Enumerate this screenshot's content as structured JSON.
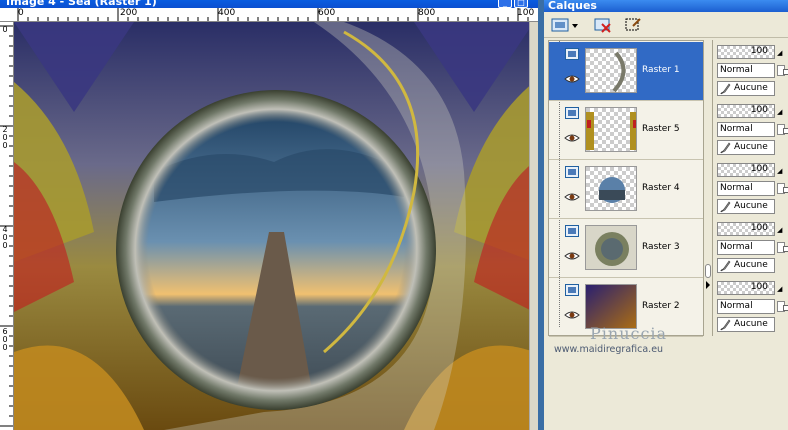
{
  "image_window": {
    "title": "Image 4 - Sea (Raster 1)",
    "ruler_h_labels": [
      "0",
      "200",
      "400",
      "600",
      "800",
      "100"
    ],
    "ruler_v_labels": [
      "0",
      "2 0 0",
      "4 0 0",
      "6 0 0"
    ],
    "title_buttons": [
      "_",
      "□"
    ]
  },
  "layers_panel": {
    "title": "Calques",
    "layers": [
      {
        "name": "Raster 1",
        "selected": true,
        "opacity": "100",
        "blend": "Normal",
        "mask": "Aucune",
        "thumb": "arc"
      },
      {
        "name": "Raster 5",
        "selected": false,
        "opacity": "100",
        "blend": "Normal",
        "mask": "Aucune",
        "thumb": "sides"
      },
      {
        "name": "Raster 4",
        "selected": false,
        "opacity": "100",
        "blend": "Normal",
        "mask": "Aucune",
        "thumb": "lens"
      },
      {
        "name": "Raster 3",
        "selected": false,
        "opacity": "100",
        "blend": "Normal",
        "mask": "Aucune",
        "thumb": "sphere"
      },
      {
        "name": "Raster 2",
        "selected": false,
        "opacity": "100",
        "blend": "Normal",
        "mask": "Aucune",
        "thumb": "gradient"
      }
    ]
  },
  "watermark": {
    "name": "Pinuccia",
    "url": "www.maidiregrafica.eu"
  },
  "colors": {
    "selection": "#316ac5",
    "title_bar": "#0b4fd0",
    "panel_bg": "#ece9d8"
  },
  "icons": [
    "new-layer-icon",
    "delete-layer-icon",
    "mask-layer-icon",
    "eye-icon",
    "raster-layer-icon",
    "paintbrush-icon"
  ]
}
